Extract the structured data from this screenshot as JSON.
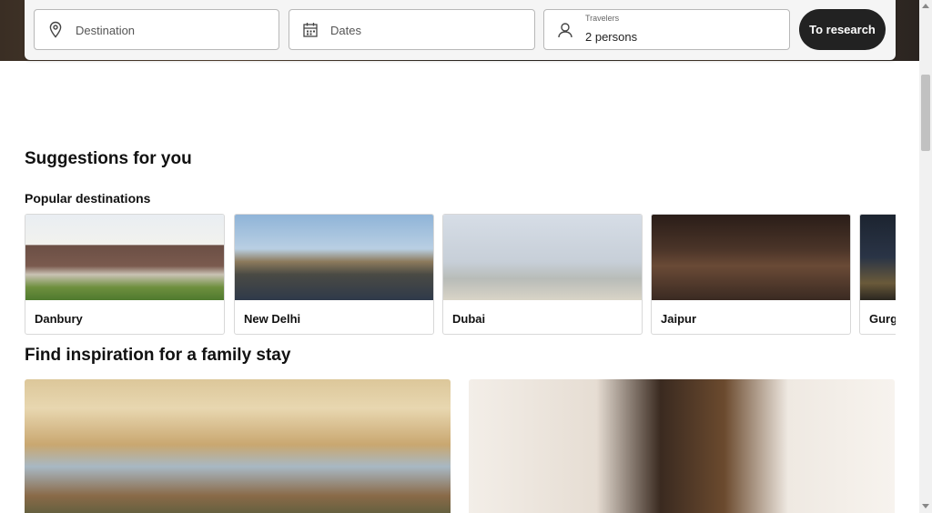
{
  "search": {
    "destination_placeholder": "Destination",
    "dates_placeholder": "Dates",
    "travelers_label": "Travelers",
    "travelers_value": "2 persons",
    "submit_label": "To research"
  },
  "suggestions": {
    "title": "Suggestions for you",
    "popular_title": "Popular destinations",
    "destinations": [
      {
        "name": "Danbury"
      },
      {
        "name": "New Delhi"
      },
      {
        "name": "Dubai"
      },
      {
        "name": "Jaipur"
      },
      {
        "name": "Gurg"
      }
    ]
  },
  "family": {
    "title": "Find inspiration for a family stay"
  },
  "colors": {
    "button_bg": "#222222",
    "border": "#b8b8b8"
  },
  "icons": {
    "destination": "map-pin-icon",
    "dates": "calendar-icon",
    "travelers": "person-icon"
  }
}
